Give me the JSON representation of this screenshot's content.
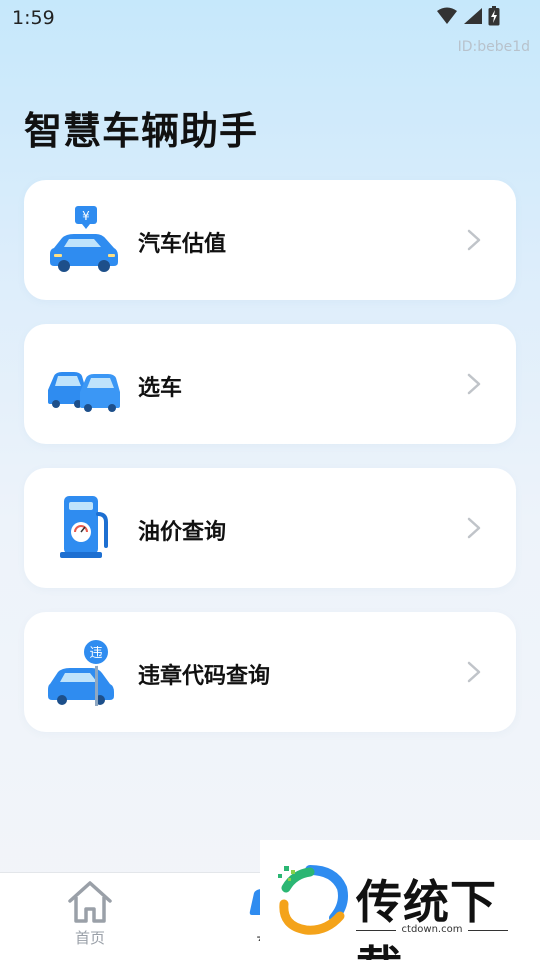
{
  "status_bar": {
    "time": "1:59",
    "icons": [
      "wifi-icon",
      "signal-icon",
      "battery-icon"
    ]
  },
  "user_id": "ID:bebe1d",
  "title": "智慧车辆助手",
  "menu": [
    {
      "label": "汽车估值",
      "icon": "car-valuation-icon"
    },
    {
      "label": "选车",
      "icon": "car-selection-icon"
    },
    {
      "label": "油价查询",
      "icon": "fuel-pump-icon"
    },
    {
      "label": "违章代码查询",
      "icon": "violation-code-icon"
    }
  ],
  "tab_bar": {
    "home_label": "首页",
    "second_label": "车"
  },
  "watermark": {
    "text": "传统下载",
    "url": "ctdown.com"
  },
  "colors": {
    "accent_blue": "#2f8cf0",
    "card_bg": "#ffffff",
    "chevron": "#c0c4c9"
  }
}
